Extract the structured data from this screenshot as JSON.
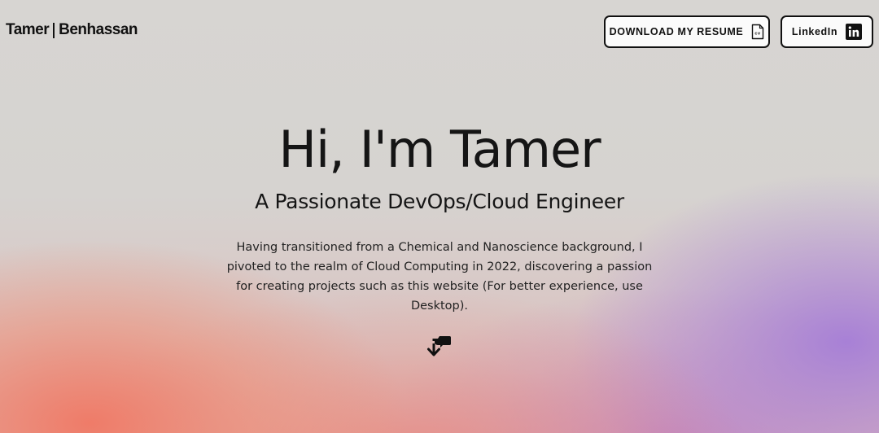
{
  "header": {
    "logo_first": "Tamer",
    "logo_last": "Benhassan",
    "resume_button": "DOWNLOAD MY RESUME",
    "resume_icon_text": "cv",
    "linkedin_button": "LinkedIn",
    "linkedin_icon_text": "in"
  },
  "hero": {
    "title": "Hi, I'm Tamer",
    "subtitle": "A Passionate DevOps/Cloud Engineer",
    "description": "Having transitioned from a Chemical and Nanoscience background, I pivoted to the realm of Cloud Computing in 2022, discovering a passion for creating projects such as this website (For better experience, use Desktop)."
  },
  "icons": {
    "resume": "cv-file-icon",
    "linkedin": "linkedin-icon",
    "scroll": "scroll-down-arrow-icon"
  },
  "colors": {
    "text": "#111111",
    "background": "#d8d6d3",
    "gradient_orange": "#f07864",
    "gradient_purple": "#a57dd7"
  }
}
